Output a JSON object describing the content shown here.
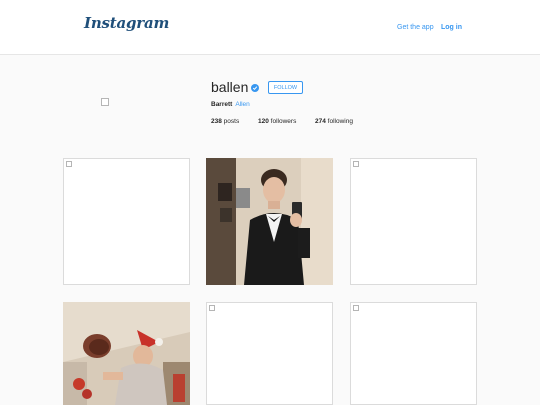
{
  "header": {
    "logo": "Instagram",
    "get_app": "Get the app",
    "login": "Log in"
  },
  "profile": {
    "username": "ballen",
    "follow_label": "FOLLOW",
    "first_name": "Barrett",
    "last_name": "Allen",
    "posts_count": "238",
    "posts_label": "posts",
    "followers_count": "120",
    "followers_label": "followers",
    "following_count": "274",
    "following_label": "following"
  },
  "colors": {
    "accent": "#3897f0",
    "logo": "#1f4f7a",
    "background": "#fafafa"
  },
  "posts": [
    {
      "type": "broken-image"
    },
    {
      "type": "photo",
      "subject": "man in tuxedo mirror selfie"
    },
    {
      "type": "broken-image"
    },
    {
      "type": "photo",
      "subject": "man in santa hat"
    },
    {
      "type": "broken-image"
    },
    {
      "type": "broken-image"
    }
  ]
}
